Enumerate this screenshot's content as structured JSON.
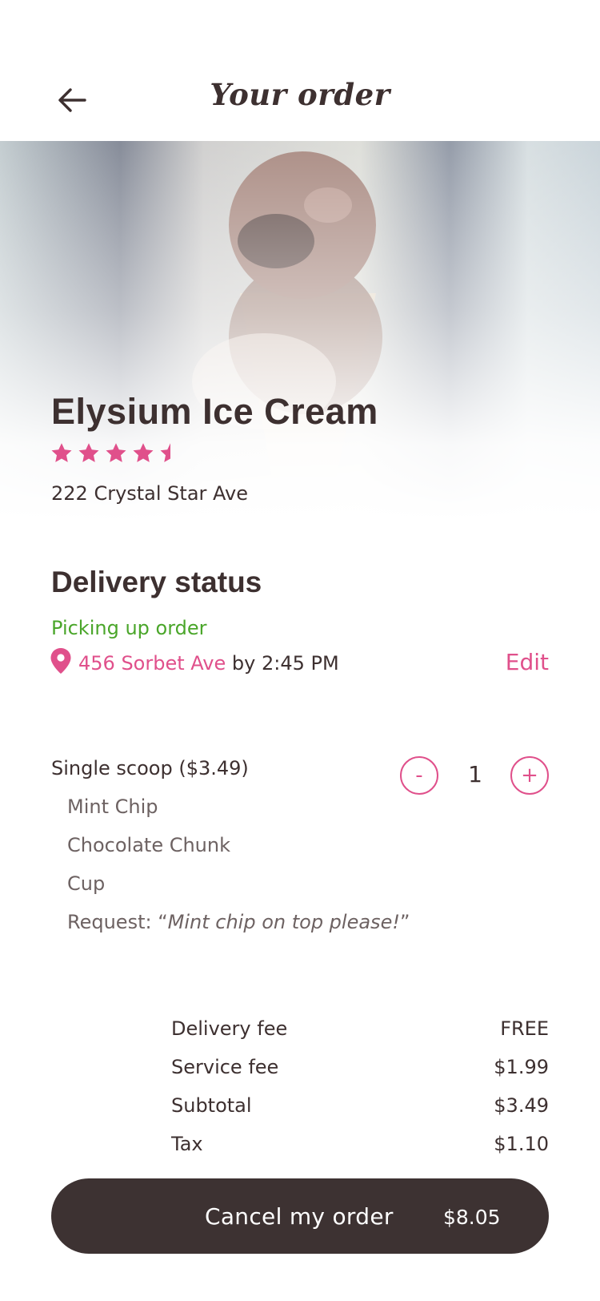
{
  "header": {
    "title": "Your order",
    "back_icon": "back-arrow-icon"
  },
  "store": {
    "name": "Elysium Ice Cream",
    "rating": 4.5,
    "rating_max": 5,
    "address": "222 Crystal Star Ave"
  },
  "delivery": {
    "title": "Delivery status",
    "state": "Picking up order",
    "destination": "456 Sorbet Ave",
    "eta": "by 2:45 PM",
    "edit_label": "Edit",
    "pin_icon": "location-pin-icon"
  },
  "item": {
    "name": "Single scoop ($3.49)",
    "options": [
      "Mint Chip",
      "Chocolate Chunk",
      "Cup"
    ],
    "request_label": "Request: “",
    "request_note": "Mint chip on top please!",
    "request_close": "”",
    "qty_minus": "-",
    "qty_plus": "+",
    "quantity": "1"
  },
  "summary": {
    "rows": [
      {
        "label": "Delivery fee",
        "value": "FREE"
      },
      {
        "label": "Service fee",
        "value": "$1.99"
      },
      {
        "label": "Subtotal",
        "value": "$3.49"
      },
      {
        "label": "Tax",
        "value": "$1.10"
      }
    ]
  },
  "cta": {
    "label": "Cancel my order",
    "total": "$8.05"
  },
  "colors": {
    "accent": "#e0508b",
    "status_green": "#4aa62a",
    "text_dark": "#3d3030",
    "button_bg": "#3d3232"
  }
}
